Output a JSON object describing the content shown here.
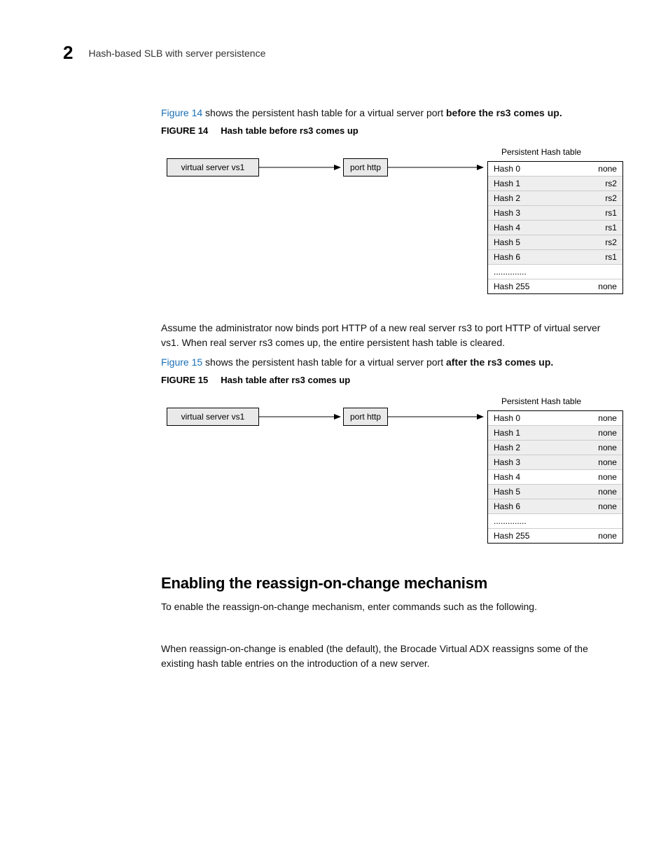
{
  "header": {
    "chapter_number": "2",
    "section_title": "Hash-based SLB with server persistence"
  },
  "intro": {
    "fig14_link": "Figure 14",
    "fig14_sentence_rest": " shows the persistent hash table for a virtual server port ",
    "fig14_bold_tail": "before the rs3 comes up."
  },
  "figure14": {
    "label": "FIGURE 14",
    "caption": "Hash table before rs3 comes up",
    "vs_label": "virtual server vs1",
    "port_label": "port http",
    "table_title": "Persistent Hash table",
    "rows": [
      {
        "k": "Hash 0",
        "v": "none",
        "shaded": false
      },
      {
        "k": "Hash 1",
        "v": "rs2",
        "shaded": true
      },
      {
        "k": "Hash 2",
        "v": "rs2",
        "shaded": true
      },
      {
        "k": "Hash 3",
        "v": "rs1",
        "shaded": true
      },
      {
        "k": "Hash 4",
        "v": "rs1",
        "shaded": true
      },
      {
        "k": "Hash 5",
        "v": "rs2",
        "shaded": true
      },
      {
        "k": "Hash 6",
        "v": "rs1",
        "shaded": true
      },
      {
        "k": "..............",
        "v": "",
        "shaded": false
      },
      {
        "k": "Hash 255",
        "v": "none",
        "shaded": false
      }
    ]
  },
  "mid_paragraph": "Assume the administrator now binds port HTTP of a new real server rs3 to port HTTP of virtual server vs1. When real server rs3 comes up, the entire persistent hash table is cleared.",
  "intro2": {
    "fig15_link": "Figure 15",
    "fig15_sentence_rest": " shows the persistent hash table for a virtual server port ",
    "fig15_bold_tail": "after the rs3 comes up."
  },
  "figure15": {
    "label": "FIGURE 15",
    "caption": "Hash table after rs3 comes up",
    "vs_label": "virtual server vs1",
    "port_label": "port http",
    "table_title": "Persistent Hash table",
    "rows": [
      {
        "k": "Hash 0",
        "v": "none",
        "shaded": false
      },
      {
        "k": "Hash 1",
        "v": "none",
        "shaded": true
      },
      {
        "k": "Hash 2",
        "v": "none",
        "shaded": true
      },
      {
        "k": "Hash 3",
        "v": "none",
        "shaded": true
      },
      {
        "k": "Hash 4",
        "v": "none",
        "shaded": false
      },
      {
        "k": "Hash 5",
        "v": "none",
        "shaded": true
      },
      {
        "k": "Hash 6",
        "v": "none",
        "shaded": true
      },
      {
        "k": "..............",
        "v": "",
        "shaded": false
      },
      {
        "k": "Hash 255",
        "v": "none",
        "shaded": false
      }
    ]
  },
  "section": {
    "heading": "Enabling the reassign-on-change mechanism",
    "p1": "To enable the reassign-on-change mechanism, enter commands such as the following.",
    "p2": "When reassign-on-change is enabled (the default), the Brocade Virtual ADX reassigns some of the existing hash table entries on the introduction of a new server."
  }
}
